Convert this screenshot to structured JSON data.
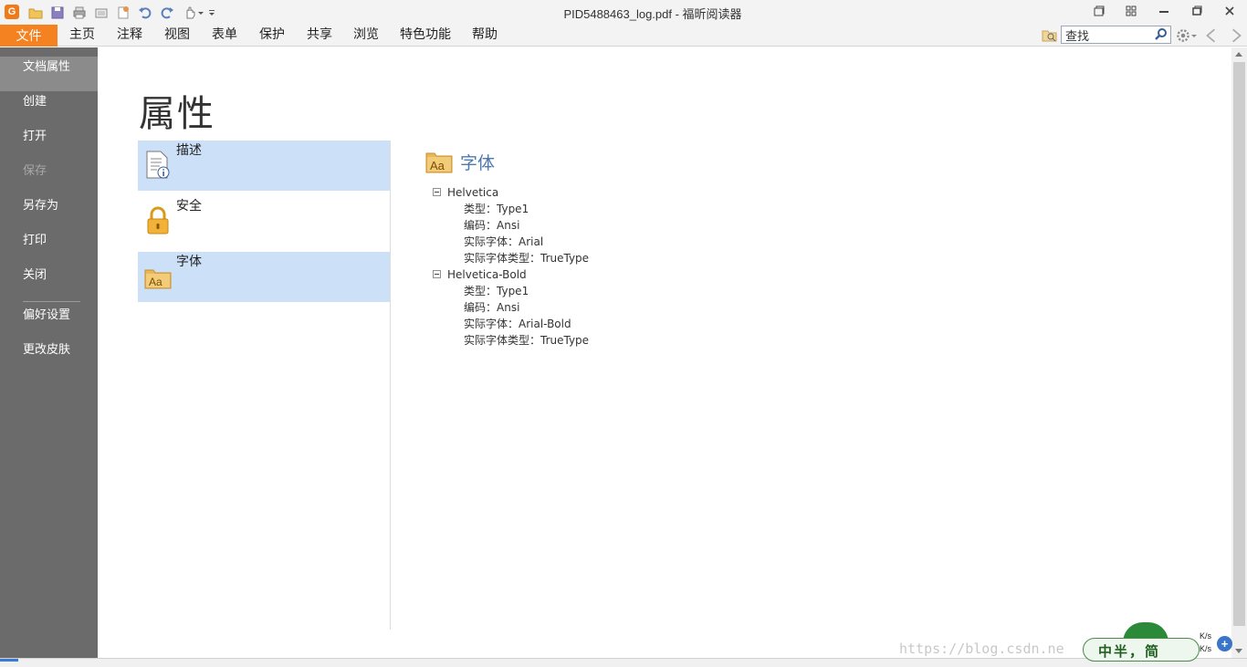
{
  "window": {
    "title": "PID5488463_log.pdf - 福昕阅读器",
    "app_logo_letter": "G"
  },
  "quick_access": [
    {
      "name": "open-icon",
      "color": "#e8b84a"
    },
    {
      "name": "save-icon",
      "color": "#7d6fb0"
    },
    {
      "name": "print-icon",
      "color": "#8a8a8a"
    },
    {
      "name": "scan-icon",
      "color": "#8a8a8a"
    },
    {
      "name": "new-icon",
      "color": "#d88a4a"
    },
    {
      "name": "undo-icon",
      "color": "#5a7fbf"
    },
    {
      "name": "redo-icon",
      "color": "#5a7fbf"
    },
    {
      "name": "hand-tool-icon",
      "color": "#8a8a8a"
    }
  ],
  "menu": {
    "file": "文件",
    "items": [
      "主页",
      "注释",
      "视图",
      "表单",
      "保护",
      "共享",
      "浏览",
      "特色功能",
      "帮助"
    ]
  },
  "search": {
    "value": "查找",
    "placeholder": ""
  },
  "sidebar": {
    "items": [
      {
        "label": "文档属性",
        "state": "active"
      },
      {
        "label": "创建",
        "state": "normal"
      },
      {
        "label": "打开",
        "state": "normal"
      },
      {
        "label": "保存",
        "state": "disabled"
      },
      {
        "label": "另存为",
        "state": "normal"
      },
      {
        "label": "打印",
        "state": "normal"
      },
      {
        "label": "关闭",
        "state": "normal"
      }
    ],
    "items_bottom": [
      {
        "label": "偏好设置"
      },
      {
        "label": "更改皮肤"
      }
    ]
  },
  "main": {
    "page_title": "属性",
    "tabs": [
      {
        "label": "描述",
        "icon": "document-info-icon",
        "selected": true
      },
      {
        "label": "安全",
        "icon": "lock-icon",
        "selected": false
      },
      {
        "label": "字体",
        "icon": "font-folder-icon",
        "selected": true
      }
    ],
    "section": {
      "title": "字体",
      "icon": "font-folder-icon"
    },
    "fonts": [
      {
        "name": "Helvetica",
        "props": [
          "类型：Type1",
          "编码：Ansi",
          "实际字体：Arial",
          "实际字体类型：TrueType"
        ]
      },
      {
        "name": "Helvetica-Bold",
        "props": [
          "类型：Type1",
          "编码：Ansi",
          "实际字体：Arial-Bold",
          "实际字体类型：TrueType"
        ]
      }
    ]
  },
  "overlay": {
    "watermark": "https://blog.csdn.ne",
    "ime_text": "中半，简",
    "net_speed": [
      "K/s",
      "K/s"
    ]
  },
  "colors": {
    "accent": "#f58220",
    "sidebar": "#6b6b6b",
    "selected_tab": "#cce0f8",
    "section_title": "#4f78b0"
  }
}
